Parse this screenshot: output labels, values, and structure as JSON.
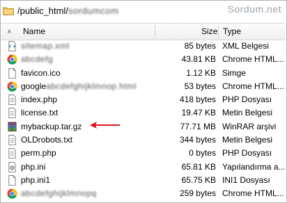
{
  "path": {
    "prefix": "/public_html/",
    "redacted": "sordumcom"
  },
  "watermark": "Sordum.net",
  "columns": {
    "name": "Name",
    "size": "Size",
    "type": "Type"
  },
  "files": [
    {
      "name": "sitemap.xml",
      "redacted": true,
      "size": "85 bytes",
      "type": "XML Belgesi",
      "icon": "xml-file-icon"
    },
    {
      "name": "abcdefg",
      "redacted": true,
      "size": "43.81 KB",
      "type": "Chrome HTML...",
      "icon": "chrome-icon"
    },
    {
      "name": "favicon.ico",
      "redacted": false,
      "size": "1.12 KB",
      "type": "Simge",
      "icon": "generic-file-icon"
    },
    {
      "name": "google",
      "redacted": false,
      "suffix": "abcdefghijklmnop.html",
      "size": "53 bytes",
      "type": "Chrome HTML...",
      "icon": "chrome-icon"
    },
    {
      "name": "index.php",
      "redacted": false,
      "size": "418 bytes",
      "type": "PHP Dosyası",
      "icon": "text-file-icon"
    },
    {
      "name": "license.txt",
      "redacted": false,
      "size": "19.47 KB",
      "type": "Metin Belgesi",
      "icon": "text-file-icon"
    },
    {
      "name": "mybackup.tar.gz",
      "redacted": false,
      "size": "77.71 MB",
      "type": "WinRAR arşivi",
      "icon": "winrar-icon"
    },
    {
      "name": "OLDrobots.txt",
      "redacted": false,
      "size": "344 bytes",
      "type": "Metin Belgesi",
      "icon": "text-file-icon"
    },
    {
      "name": "perm.php",
      "redacted": false,
      "size": "0 bytes",
      "type": "PHP Dosyası",
      "icon": "text-file-icon"
    },
    {
      "name": "php.ini",
      "redacted": false,
      "size": "65.81 KB",
      "type": "Yapılandırma a...",
      "icon": "config-file-icon"
    },
    {
      "name": "php.ini1",
      "redacted": false,
      "size": "65.75 KB",
      "type": "INI1 Dosyası",
      "icon": "generic-file-icon"
    },
    {
      "name": "abcdefghijklmnopq",
      "redacted": true,
      "size": "259 bytes",
      "type": "Chrome HTML...",
      "icon": "chrome-icon"
    }
  ],
  "colors": {
    "arrow": "#e0141e",
    "folder": "#e8c25a",
    "chrome_red": "#db4437",
    "chrome_yellow": "#f4c20d",
    "chrome_green": "#0f9d58",
    "chrome_blue": "#4285f4"
  }
}
